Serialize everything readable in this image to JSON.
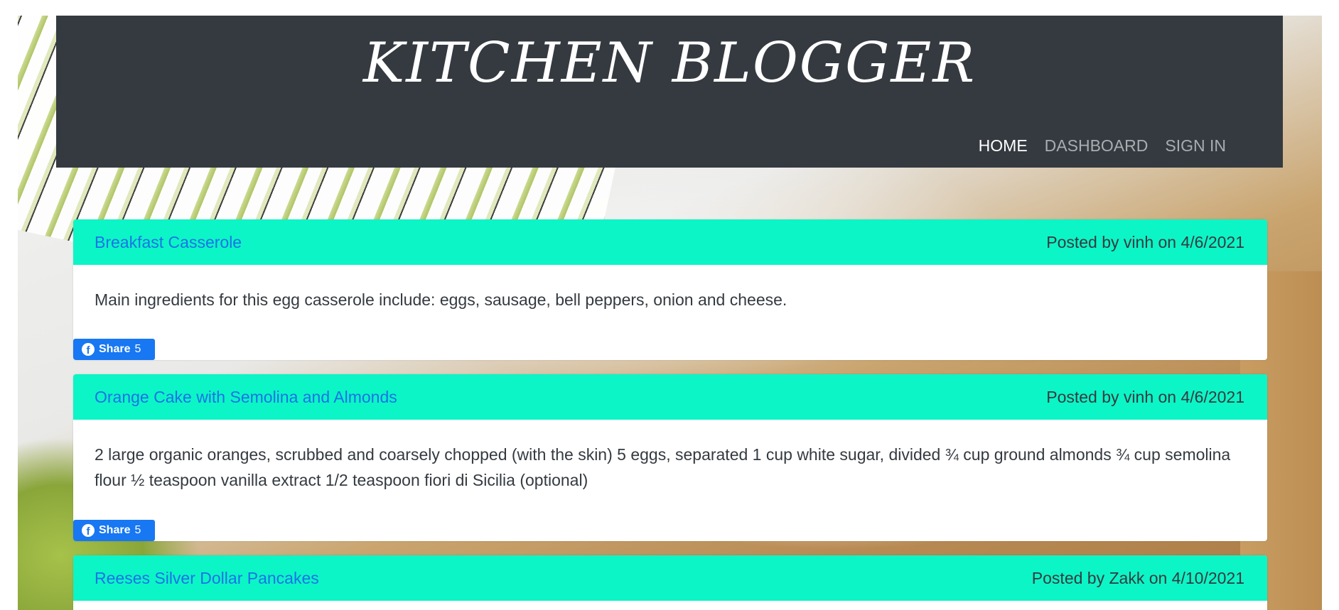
{
  "site": {
    "brand": "KITCHEN BLOGGER",
    "nav": [
      {
        "label": "HOME",
        "active": true
      },
      {
        "label": "DASHBOARD",
        "active": false
      },
      {
        "label": "SIGN IN",
        "active": false
      }
    ]
  },
  "posts": [
    {
      "title": "Breakfast Casserole",
      "meta": "Posted by vinh on 4/6/2021",
      "body": "Main ingredients for this egg casserole include: eggs, sausage, bell peppers, onion and cheese.",
      "share_label": "Share",
      "share_count": "5"
    },
    {
      "title": "Orange Cake with Semolina and Almonds",
      "meta": "Posted by vinh on 4/6/2021",
      "body": "2 large organic oranges, scrubbed and coarsely chopped (with the skin) 5 eggs, separated 1 cup white sugar, divided ¾ cup ground almonds ¾ cup semolina flour ½ teaspoon vanilla extract 1/2 teaspoon fiori di Sicilia (optional)",
      "share_label": "Share",
      "share_count": "5"
    },
    {
      "title": "Reeses Silver Dollar Pancakes",
      "meta": "Posted by Zakk on 4/10/2021"
    }
  ],
  "colors": {
    "header_bg": "#343a40",
    "post_header_bg": "#0cf5c6",
    "link": "#1a73e8",
    "facebook": "#1877f2"
  },
  "icons": {
    "share": "facebook-icon"
  }
}
